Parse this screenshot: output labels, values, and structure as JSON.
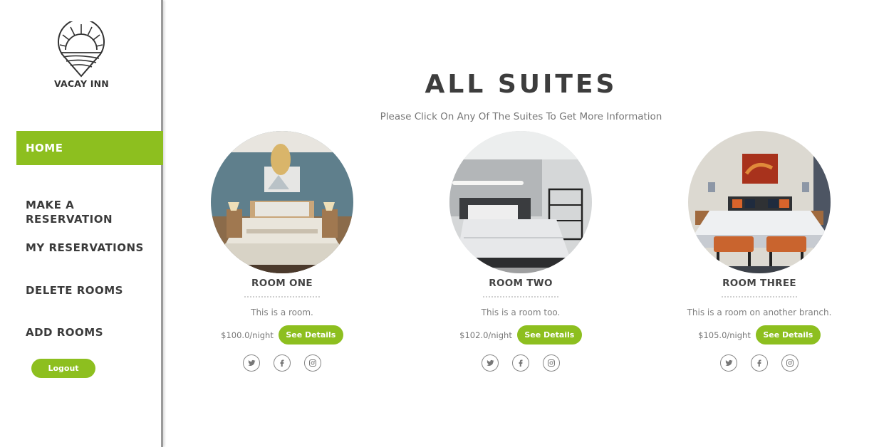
{
  "brand": {
    "name": "VACAY INN",
    "logo_icon": "sun-pin-logo-icon"
  },
  "nav": {
    "items": [
      {
        "label": "HOME",
        "active": true
      },
      {
        "label": "MAKE A\nRESERVATION",
        "active": false
      },
      {
        "label": "MY RESERVATIONS",
        "active": false
      },
      {
        "label": "DELETE ROOMS",
        "active": false
      },
      {
        "label": "ADD ROOMS",
        "active": false
      }
    ],
    "logout_label": "Logout"
  },
  "main": {
    "title": "ALL SUITES",
    "subtitle": "Please Click On Any Of The Suites To Get More Information"
  },
  "rooms": [
    {
      "name": "ROOM ONE",
      "description": "This is a room.",
      "price": "$100.0/night",
      "button": "See Details"
    },
    {
      "name": "ROOM TWO",
      "description": "This is a room too.",
      "price": "$102.0/night",
      "button": "See Details"
    },
    {
      "name": "ROOM THREE",
      "description": "This is a room on another branch.",
      "price": "$105.0/night",
      "button": "See Details"
    }
  ],
  "social_icons": [
    "twitter-icon",
    "facebook-icon",
    "instagram-icon"
  ],
  "colors": {
    "accent": "#8dbf1f",
    "text_dark": "#3d3d3d",
    "text_muted": "#777777"
  }
}
